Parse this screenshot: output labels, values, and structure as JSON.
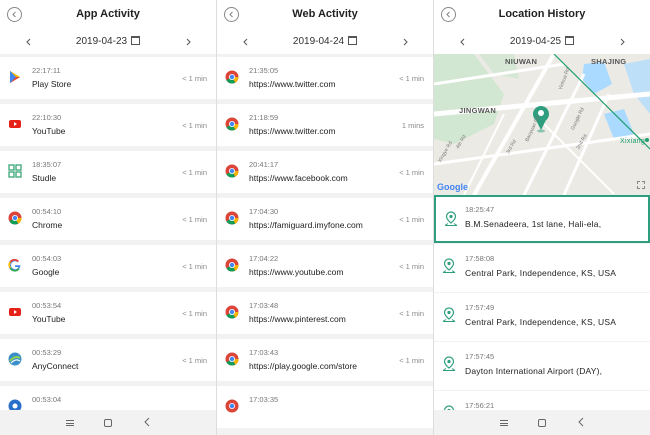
{
  "app_panel": {
    "title": "App Activity",
    "date": "2019-04-23",
    "items": [
      {
        "time": "22:17:11",
        "name": "Play Store",
        "duration": "< 1 min",
        "icon": "play-store-icon"
      },
      {
        "time": "22:10:30",
        "name": "YouTube",
        "duration": "< 1 min",
        "icon": "youtube-icon"
      },
      {
        "time": "18:35:07",
        "name": "Studle",
        "duration": "< 1 min",
        "icon": "studle-icon"
      },
      {
        "time": "00:54:10",
        "name": "Chrome",
        "duration": "< 1 min",
        "icon": "chrome-icon"
      },
      {
        "time": "00:54:03",
        "name": "Google",
        "duration": "< 1 min",
        "icon": "google-icon"
      },
      {
        "time": "00:53:54",
        "name": "YouTube",
        "duration": "< 1 min",
        "icon": "youtube-icon"
      },
      {
        "time": "00:53:29",
        "name": "AnyConnect",
        "duration": "< 1 min",
        "icon": "anyconnect-icon"
      },
      {
        "time": "00:53:04",
        "name": "",
        "duration": "",
        "icon": "app-icon"
      }
    ]
  },
  "web_panel": {
    "title": "Web Activity",
    "date": "2019-04-24",
    "items": [
      {
        "time": "21:35:05",
        "url": "https://www.twitter.com",
        "duration": "< 1 min"
      },
      {
        "time": "21:18:59",
        "url": "https://www.twitter.com",
        "duration": "1 mins"
      },
      {
        "time": "20:41:17",
        "url": "https://www.facebook.com",
        "duration": "< 1 min"
      },
      {
        "time": "17:04:30",
        "url": "https://famiguard.imyfone.com",
        "duration": "< 1 min"
      },
      {
        "time": "17:04:22",
        "url": "https://www.youtube.com",
        "duration": "< 1 min"
      },
      {
        "time": "17:03:48",
        "url": "https://www.pinterest.com",
        "duration": "< 1 min"
      },
      {
        "time": "17:03:43",
        "url": "https://play.google.com/store",
        "duration": "< 1 min"
      },
      {
        "time": "17:03:35",
        "url": "",
        "duration": ""
      }
    ]
  },
  "location_panel": {
    "title": "Location History",
    "date": "2019-04-25",
    "map": {
      "districts": [
        "NIUWAN",
        "SHAJING",
        "JINGWAN",
        "Xixiang"
      ],
      "roads": [
        "Yinhua Rd",
        "Baoyuan Rd",
        "Google Rd",
        "4th Rd",
        "3rd Rd",
        "2nd Rd",
        "Xingye Rd"
      ],
      "attribution": "Google"
    },
    "items": [
      {
        "time": "18:25:47",
        "address": "B.M.Senadeera, 1st lane, Hali-ela,"
      },
      {
        "time": "17:58:08",
        "address": "Central Park, Independence, KS, USA"
      },
      {
        "time": "17:57:49",
        "address": "Central Park, Independence, KS, USA"
      },
      {
        "time": "17:57:45",
        "address": "Dayton International Airport (DAY),"
      },
      {
        "time": "17:56:21",
        "address": ""
      }
    ]
  },
  "colors": {
    "accent": "#2e9e7e",
    "youtube": "#e62117",
    "studle": "#3aa676"
  }
}
